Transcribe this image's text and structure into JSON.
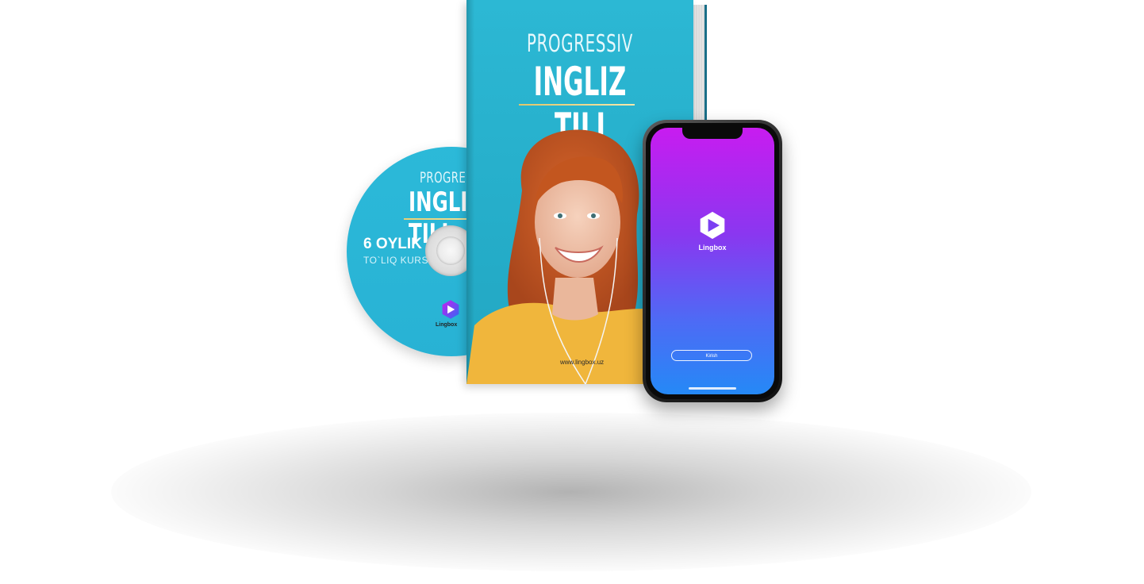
{
  "colors": {
    "cover_teal": "#2cb8d4",
    "accent_gold": "#e2c66a",
    "phone_gradient_top": "#c81cf0",
    "phone_gradient_bottom": "#2589f6",
    "logo_purple": "#7b3ff2"
  },
  "cd": {
    "title_small": "PROGRESSIV",
    "title_big": "INGLIZ TILI",
    "months_label": "6 OYLIK",
    "course_label": "TO`LIQ KURS",
    "logo_icon": "lingbox-logo-icon",
    "brand": "Lingbox"
  },
  "book": {
    "title_small": "PROGRESSIV",
    "title_big": "INGLIZ TILI",
    "url": "www.lingbox.uz"
  },
  "phone": {
    "logo_icon": "lingbox-logo-icon",
    "brand": "Lingbox",
    "login_button": "Kirish"
  }
}
